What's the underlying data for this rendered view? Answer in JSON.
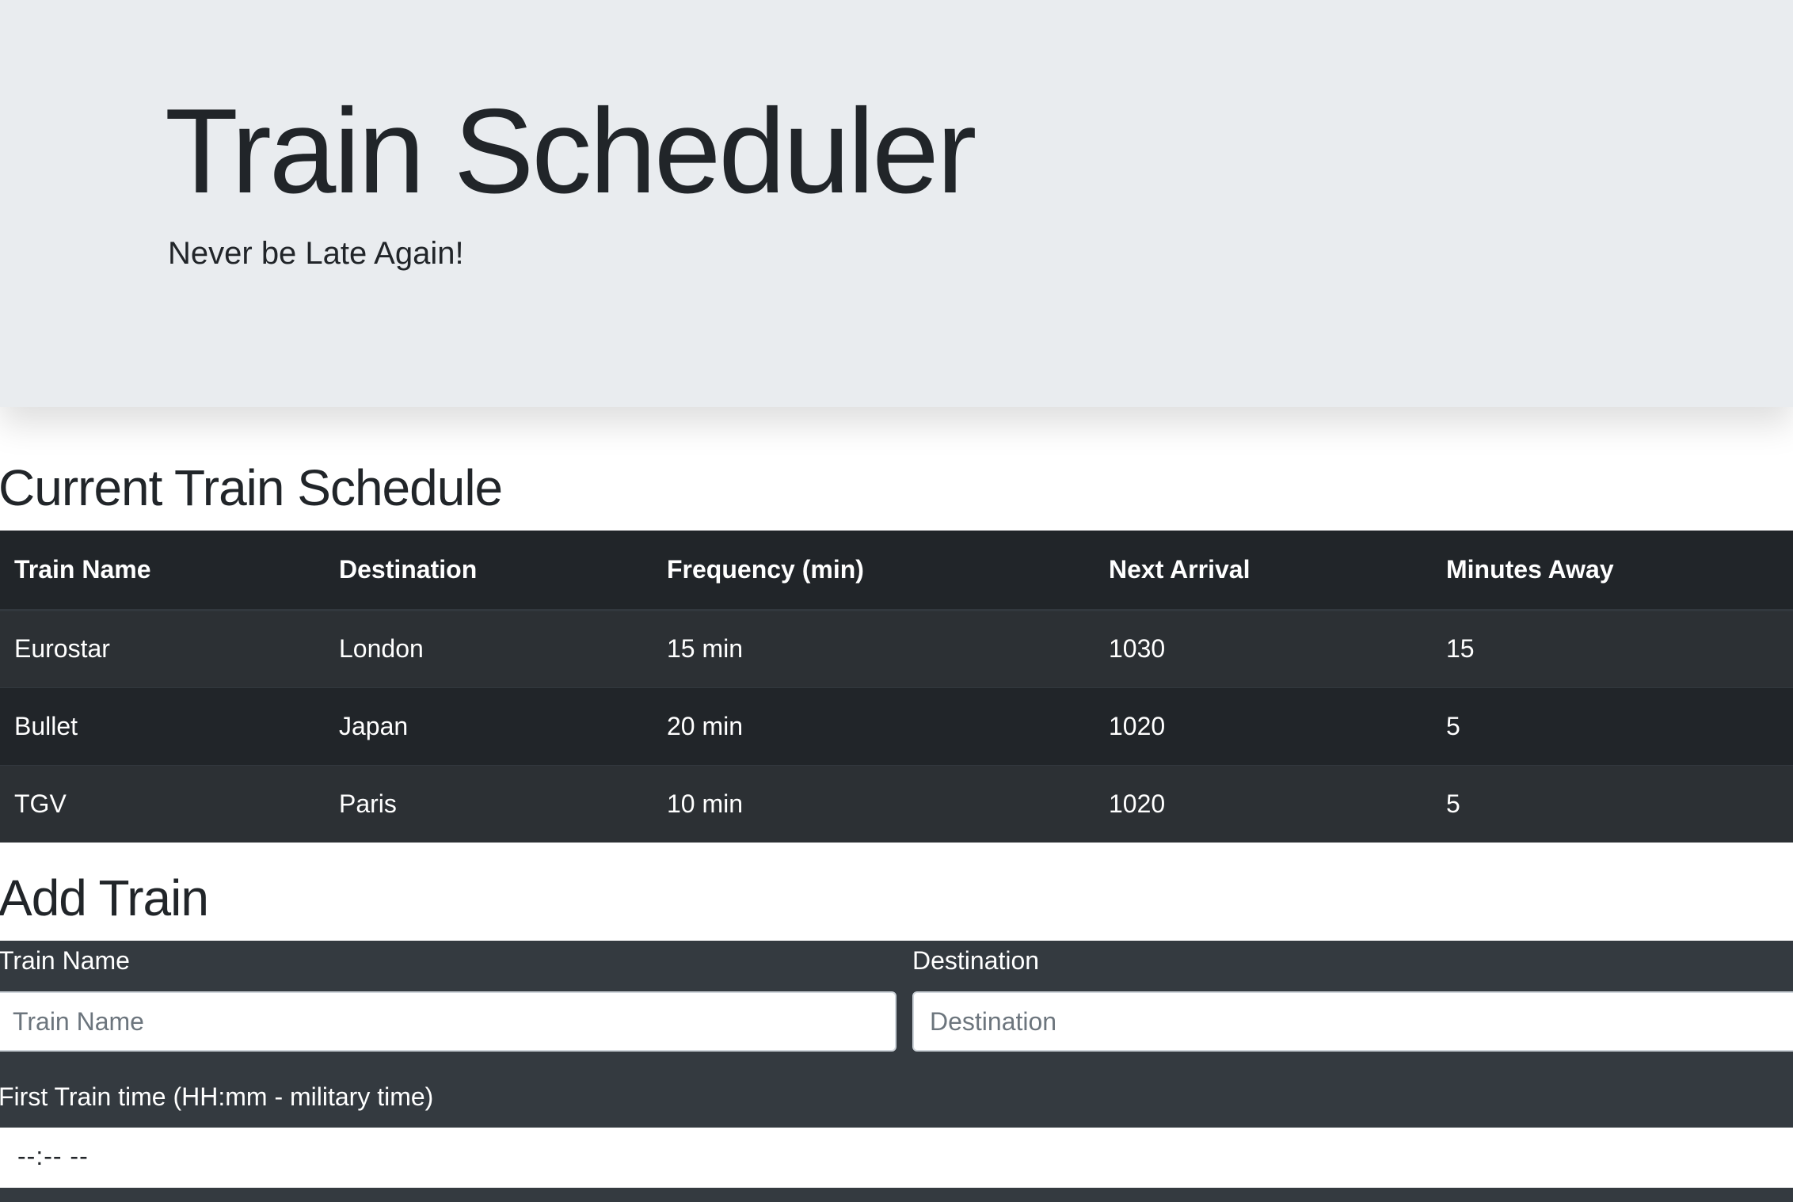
{
  "jumbotron": {
    "title": "Train Scheduler",
    "lead": "Never be Late Again!"
  },
  "schedule": {
    "heading": "Current Train Schedule",
    "columns": [
      "Train Name",
      "Destination",
      "Frequency (min)",
      "Next Arrival",
      "Minutes Away"
    ],
    "rows": [
      [
        "Eurostar",
        "London",
        "15 min",
        "1030",
        "15"
      ],
      [
        "Bullet",
        "Japan",
        "20 min",
        "1020",
        "5"
      ],
      [
        "TGV",
        "Paris",
        "10 min",
        "1020",
        "5"
      ]
    ]
  },
  "add_train": {
    "heading": "Add Train",
    "train_name_label": "Train Name",
    "train_name_placeholder": "Train Name",
    "destination_label": "Destination",
    "destination_placeholder": "Destination",
    "first_time_label": "First Train time (HH:mm - military time)",
    "first_time_value": "--:-- --"
  }
}
